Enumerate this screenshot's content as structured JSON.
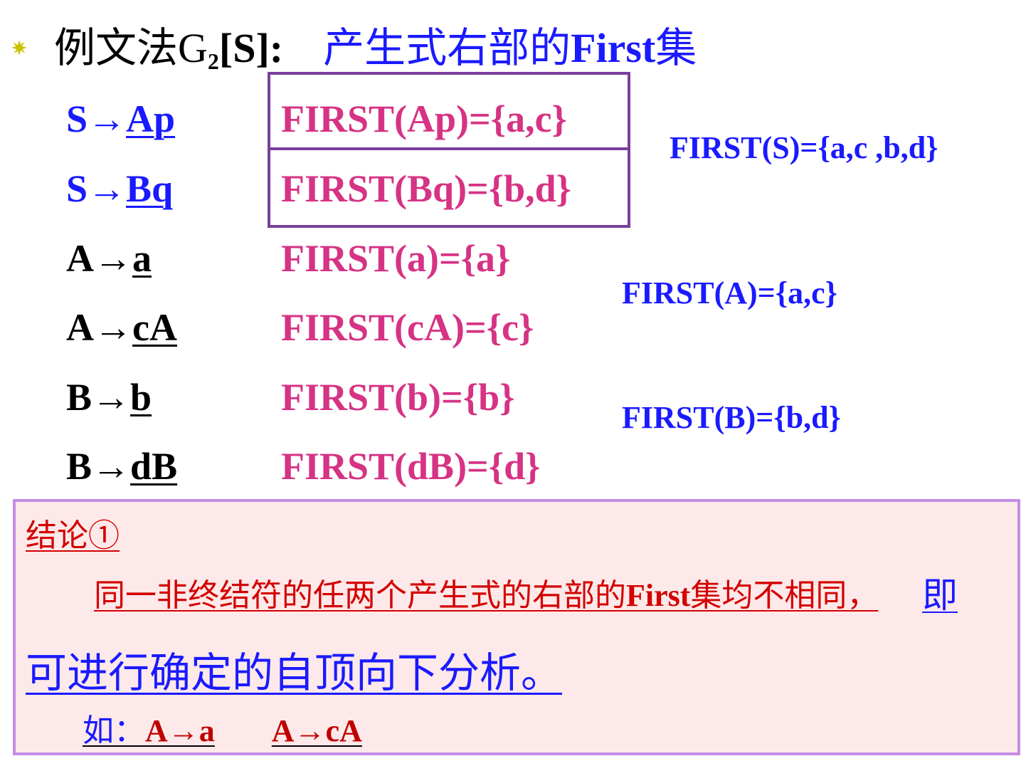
{
  "heading": {
    "example": "例文法G",
    "subscript": "2",
    "grammar": "[S]:",
    "topic_prefix": "产生式右部的",
    "topic_bold": "First",
    "topic_suffix": "集"
  },
  "productions": [
    {
      "lhs": "S",
      "arrow": "→",
      "rhs": "Ap",
      "first": "FIRST(Ap)={a,c}"
    },
    {
      "lhs": "S",
      "arrow": "→",
      "rhs": "Bq",
      "first": "FIRST(Bq)={b,d}"
    },
    {
      "lhs": "A",
      "arrow": "→",
      "rhs": "a",
      "first": "FIRST(a)={a}"
    },
    {
      "lhs": "A",
      "arrow": "→",
      "rhs": "cA",
      "first": "FIRST(cA)={c}"
    },
    {
      "lhs": "B",
      "arrow": "→",
      "rhs": "b",
      "first": "FIRST(b)={b}"
    },
    {
      "lhs": "B",
      "arrow": "→",
      "rhs": "dB",
      "first": "FIRST(dB)={d}"
    }
  ],
  "unions": {
    "S": "FIRST(S)={a,c ,b,d}",
    "A": "FIRST(A)={a,c}",
    "B": "FIRST(B)={b,d}"
  },
  "conclusion": {
    "title": "结论①",
    "line1_a": "同一非终结符的任两个产生式的右部的",
    "line1_bold": "First",
    "line1_b": "集均不相同，",
    "line1_blue": "即",
    "line2": "可进行确定的自顶向下分析。",
    "example_label": "如：",
    "example1": "A→a",
    "example2": "A→cA"
  },
  "colors": {
    "blue": "#1a1aff",
    "pink": "#d6317f",
    "red": "#d40000",
    "box_border": "#7a3f9b",
    "panel_bg": "#fde9e9",
    "panel_border": "#c58ce6"
  }
}
